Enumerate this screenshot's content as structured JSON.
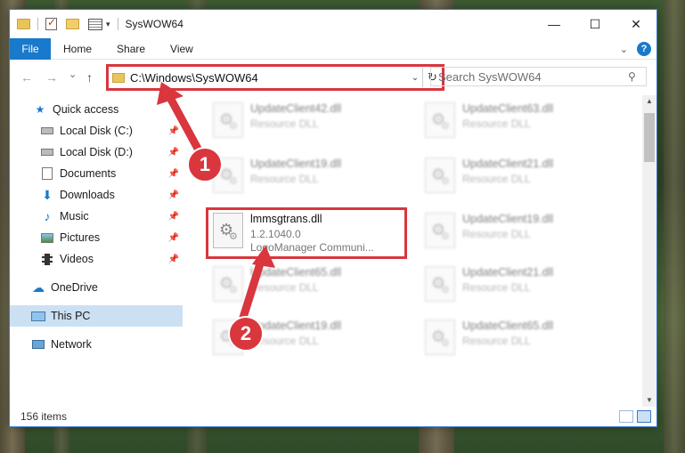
{
  "window": {
    "title": "SysWOW64",
    "controls": {
      "minimize": "—",
      "maximize": "☐",
      "close": "✕"
    }
  },
  "ribbon": {
    "tabs": [
      "File",
      "Home",
      "Share",
      "View"
    ],
    "expand_icon": "chevron-down-icon",
    "help_label": "?"
  },
  "nav": {
    "back": "←",
    "forward": "→",
    "recent": "⌄",
    "up": "↑",
    "address": "C:\\Windows\\SysWOW64",
    "search_placeholder": "Search SysWOW64"
  },
  "sidebar": {
    "items": [
      {
        "label": "Quick access",
        "icon": "star-icon",
        "pinned": false
      },
      {
        "label": "Local Disk (C:)",
        "icon": "drive-icon",
        "pinned": true
      },
      {
        "label": "Local Disk (D:)",
        "icon": "drive-icon",
        "pinned": true
      },
      {
        "label": "Documents",
        "icon": "documents-icon",
        "pinned": true
      },
      {
        "label": "Downloads",
        "icon": "download-icon",
        "pinned": true
      },
      {
        "label": "Music",
        "icon": "music-icon",
        "pinned": true
      },
      {
        "label": "Pictures",
        "icon": "pictures-icon",
        "pinned": true
      },
      {
        "label": "Videos",
        "icon": "videos-icon",
        "pinned": true
      },
      {
        "label": "OneDrive",
        "icon": "cloud-icon",
        "pinned": false
      },
      {
        "label": "This PC",
        "icon": "computer-icon",
        "pinned": false,
        "selected": true
      },
      {
        "label": "Network",
        "icon": "network-icon",
        "pinned": false
      }
    ]
  },
  "files": [
    {
      "name": "UpdateClient42.dll",
      "sub": "Resource DLL"
    },
    {
      "name": "UpdateClient63.dll",
      "sub": "Resource DLL"
    },
    {
      "name": "UpdateClient19.dll",
      "sub": "Resource DLL"
    },
    {
      "name": "UpdateClient21.dll",
      "sub": "Resource DLL"
    },
    {
      "name": "lmmsgtrans.dll",
      "sub": "1.2.1040.0",
      "sub2": "LogoManager Communi...",
      "highlighted": true
    },
    {
      "name": "UpdateClient19.dll",
      "sub": "Resource DLL"
    },
    {
      "name": "UpdateClient65.dll",
      "sub": "Resource DLL"
    },
    {
      "name": "UpdateClient21.dll",
      "sub": "Resource DLL"
    },
    {
      "name": "UpdateClient19.dll",
      "sub": "Resource DLL"
    },
    {
      "name": "UpdateClient65.dll",
      "sub": "Resource DLL"
    }
  ],
  "status": {
    "item_count": "156 items"
  },
  "callouts": [
    "1",
    "2"
  ],
  "colors": {
    "accent": "#1979ca",
    "highlight": "#d9363e",
    "selection": "#cce0f4"
  }
}
